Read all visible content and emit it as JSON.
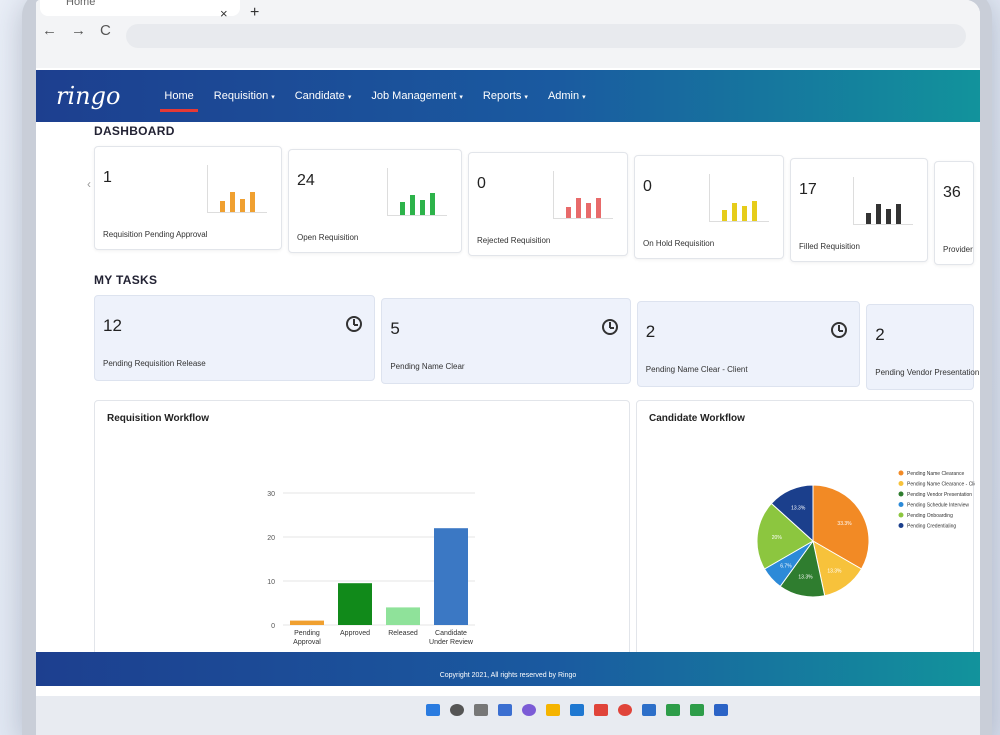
{
  "browser": {
    "tab_title": "Home",
    "tab_close": "×",
    "new_tab": "+",
    "back": "←",
    "forward": "→",
    "reload": "C"
  },
  "app": {
    "logo": "ringo",
    "nav": [
      {
        "label": "Home",
        "has_caret": false
      },
      {
        "label": "Requisition",
        "has_caret": true
      },
      {
        "label": "Candidate",
        "has_caret": true
      },
      {
        "label": "Job Management",
        "has_caret": true
      },
      {
        "label": "Reports",
        "has_caret": true
      },
      {
        "label": "Admin",
        "has_caret": true
      }
    ],
    "caret": "▾"
  },
  "dashboard": {
    "title": "DASHBOARD",
    "cards": [
      {
        "value": "1",
        "label": "Requisition Pending Approval",
        "color": "#f0a030"
      },
      {
        "value": "24",
        "label": "Open Requisition",
        "color": "#2db34a"
      },
      {
        "value": "0",
        "label": "Rejected Requisition",
        "color": "#e86a6a"
      },
      {
        "value": "0",
        "label": "On Hold Requisition",
        "color": "#e6cc1a"
      },
      {
        "value": "17",
        "label": "Filled Requisition",
        "color": "#333333"
      },
      {
        "value": "36",
        "label": "Provider",
        "color": "#888888"
      }
    ]
  },
  "tasks": {
    "title": "MY TASKS",
    "cards": [
      {
        "value": "12",
        "label": "Pending Requisition Release"
      },
      {
        "value": "5",
        "label": "Pending Name Clear"
      },
      {
        "value": "2",
        "label": "Pending Name Clear - Client"
      },
      {
        "value": "2",
        "label": "Pending Vendor Presentation"
      }
    ]
  },
  "panels": {
    "requisition_title": "Requisition Workflow",
    "candidate_title": "Candidate Workflow"
  },
  "chart_data": [
    {
      "type": "bar",
      "title": "Requisition Workflow",
      "categories": [
        "Pending Approval",
        "Approved",
        "Released",
        "Candidate Under Review"
      ],
      "values": [
        1,
        9.5,
        4,
        22
      ],
      "colors": [
        "#f0a030",
        "#118a1a",
        "#8fe29a",
        "#3b78c4"
      ],
      "ylim": [
        0,
        30
      ],
      "yticks": [
        0,
        10,
        20,
        30
      ],
      "grid": true
    },
    {
      "type": "pie",
      "title": "Candidate Workflow",
      "legend_position": "right",
      "slices": [
        {
          "name": "Pending Name Clearance",
          "value": 33.3,
          "label": "33.3%",
          "color": "#f28a25"
        },
        {
          "name": "Pending Name Clearance - Client",
          "value": 13.3,
          "label": "13.3%",
          "color": "#f7c23b"
        },
        {
          "name": "Pending Vendor Presentation",
          "value": 13.3,
          "label": "13.3%",
          "color": "#2f7d2f"
        },
        {
          "name": "Pending Schedule Interview",
          "value": 6.7,
          "label": "6.7%",
          "color": "#2c8ad8"
        },
        {
          "name": "Pending Onboarding",
          "value": 20,
          "label": "20%",
          "color": "#8cc63f"
        },
        {
          "name": "Pending Credentialing",
          "value": 13.3,
          "label": "13.3%",
          "color": "#1b3f8c"
        }
      ]
    }
  ],
  "footer": {
    "copyright": "Copyright 2021, All rights reserved by Ringo"
  }
}
